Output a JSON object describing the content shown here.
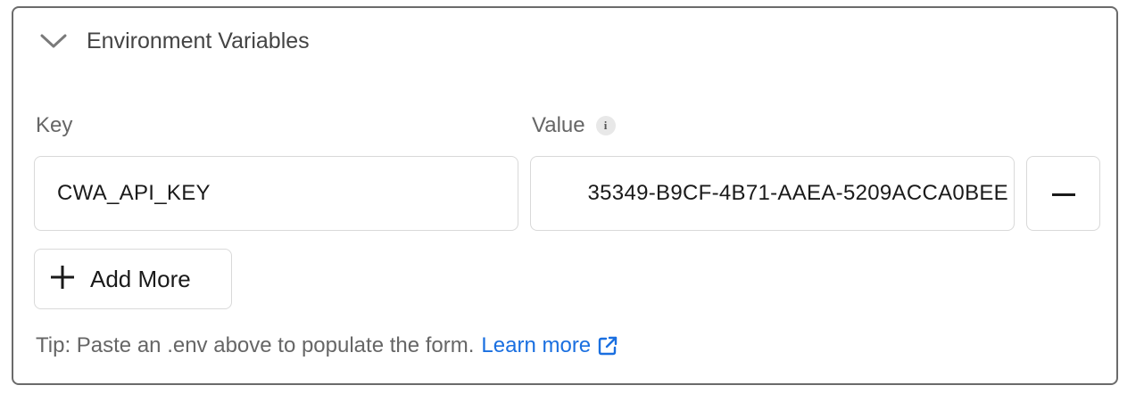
{
  "section": {
    "title": "Environment Variables",
    "collapse_icon": "chevron-down-icon"
  },
  "columns": {
    "key_label": "Key",
    "value_label": "Value",
    "info_icon": "info-icon"
  },
  "rows": [
    {
      "key": "CWA_API_KEY",
      "value": "35349-B9CF-4B71-AAEA-5209ACCA0BEE",
      "remove_icon": "minus-icon"
    }
  ],
  "add_button": {
    "label": "Add More",
    "icon": "plus-icon"
  },
  "tip": {
    "text": "Tip: Paste an .env above to populate the form.",
    "link_label": "Learn more",
    "link_icon": "external-link-icon"
  },
  "colors": {
    "border": "#6b6b6b",
    "link": "#1a6fe0",
    "text_muted": "#666666"
  }
}
